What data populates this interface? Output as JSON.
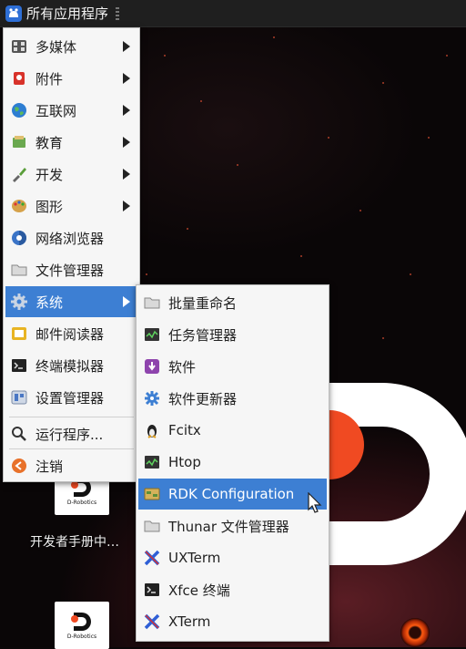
{
  "panel": {
    "apps_menu_label": "所有应用程序"
  },
  "main_menu": {
    "items": [
      {
        "label": "多媒体",
        "icon": "multimedia-icon",
        "has_submenu": true
      },
      {
        "label": "附件",
        "icon": "accessories-icon",
        "has_submenu": true
      },
      {
        "label": "互联网",
        "icon": "internet-icon",
        "has_submenu": true
      },
      {
        "label": "教育",
        "icon": "education-icon",
        "has_submenu": true
      },
      {
        "label": "开发",
        "icon": "development-icon",
        "has_submenu": true
      },
      {
        "label": "图形",
        "icon": "graphics-icon",
        "has_submenu": true
      },
      {
        "label": "网络浏览器",
        "icon": "web-browser-icon",
        "has_submenu": false
      },
      {
        "label": "文件管理器",
        "icon": "file-manager-icon",
        "has_submenu": false
      },
      {
        "label": "系统",
        "icon": "system-icon",
        "has_submenu": true,
        "active": true
      },
      {
        "label": "邮件阅读器",
        "icon": "mail-reader-icon",
        "has_submenu": false
      },
      {
        "label": "终端模拟器",
        "icon": "terminal-icon",
        "has_submenu": false
      },
      {
        "label": "设置管理器",
        "icon": "settings-manager-icon",
        "has_submenu": false
      },
      {
        "label": "运行程序...",
        "icon": "run-program-icon",
        "has_submenu": false
      },
      {
        "label": "注销",
        "icon": "logout-icon",
        "has_submenu": false
      }
    ]
  },
  "sub_menu": {
    "items": [
      {
        "label": "批量重命名",
        "icon": "bulk-rename-icon"
      },
      {
        "label": "任务管理器",
        "icon": "task-manager-icon"
      },
      {
        "label": "软件",
        "icon": "software-icon"
      },
      {
        "label": "软件更新器",
        "icon": "software-updater-icon"
      },
      {
        "label": "Fcitx",
        "icon": "fcitx-icon"
      },
      {
        "label": "Htop",
        "icon": "htop-icon"
      },
      {
        "label": "RDK Configuration",
        "icon": "rdk-configuration-icon",
        "active": true
      },
      {
        "label": "Thunar 文件管理器",
        "icon": "thunar-icon"
      },
      {
        "label": "UXTerm",
        "icon": "uxterm-icon"
      },
      {
        "label": "Xfce 终端",
        "icon": "xfce-terminal-icon"
      },
      {
        "label": "XTerm",
        "icon": "xterm-icon"
      }
    ]
  },
  "desktop": {
    "shortcut_brand": "D-Robotics",
    "shortcut_label": "开发者手册中…",
    "shortcut2_brand": "D-Robotics"
  },
  "colors": {
    "highlight": "#3d7fd3",
    "accent_orange": "#f04a22",
    "panel_bg": "#1f1f1f"
  }
}
